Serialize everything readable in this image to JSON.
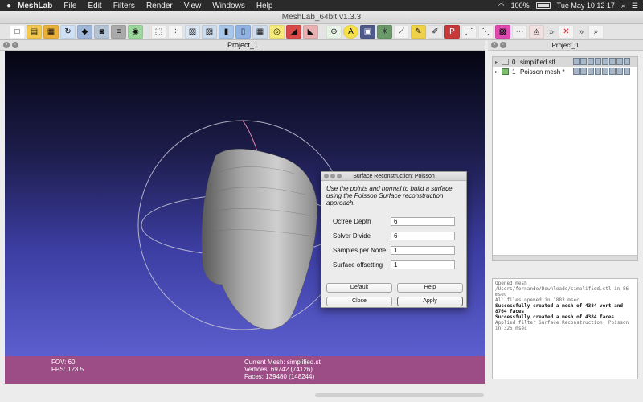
{
  "menubar": {
    "app_name": "MeshLab",
    "menus": [
      "File",
      "Edit",
      "Filters",
      "Render",
      "View",
      "Windows",
      "Help"
    ],
    "battery": "100%",
    "clock": "Tue May 10  12 17"
  },
  "window": {
    "title": "MeshLab_64bit v1.3.3"
  },
  "toolbar": {
    "icons": [
      "new-icon",
      "open-icon",
      "open-project-icon",
      "reload-icon",
      "save-icon",
      "snapshot-icon",
      "layers-icon",
      "globe-icon",
      "bbox-icon",
      "points-icon",
      "wireframe-icon",
      "hidden-lines-icon",
      "flat-icon",
      "smooth-icon",
      "texture-icon",
      "light-icon",
      "fancy-light-icon",
      "color-icon",
      "axis-icon",
      "annotation-icon",
      "selection-icon",
      "measure-icon",
      "align-icon",
      "pick-icon",
      "paint-icon",
      "paint-p-icon",
      "measure-tool-icon",
      "reference-icon",
      "color-swatch-icon",
      "raster-icon",
      "no-select-icon"
    ]
  },
  "project": {
    "title": "Project_1",
    "statusbar": {
      "fov": "FOV: 60",
      "fps": "FPS:   123.5",
      "current_mesh": "Current Mesh: simplified.stl",
      "vertices": "Vertices: 69742 (74126)",
      "faces": "Faces: 139480 (148244)"
    }
  },
  "dialog": {
    "title": "Surface Reconstruction: Poisson",
    "description": "Use the points and normal to build a surface using the Poisson Surface reconstruction approach.",
    "params": [
      {
        "label": "Octree Depth",
        "value": "6"
      },
      {
        "label": "Solver Divide",
        "value": "6"
      },
      {
        "label": "Samples per Node",
        "value": "1"
      },
      {
        "label": "Surface offsetting",
        "value": "1"
      }
    ],
    "buttons": {
      "default": "Default",
      "help": "Help",
      "close": "Close",
      "apply": "Apply"
    }
  },
  "layers_panel": {
    "title": "Project_1",
    "layers": [
      {
        "index": "0",
        "name": "simplified.stl"
      },
      {
        "index": "1",
        "name": "Poisson mesh *"
      }
    ]
  },
  "log": {
    "lines": [
      {
        "text": "Opened mesh /Users/fernando/Downloads/simplified.stl in 86 msec",
        "bold": false
      },
      {
        "text": "All files opened in 1883 msec",
        "bold": false
      },
      {
        "text": "Successfully created a mesh of 4384 vert and 8764 faces",
        "bold": true
      },
      {
        "text": "Successfully created a mesh of 4384 faces",
        "bold": true
      },
      {
        "text": "Applied filter Surface Reconstruction: Poisson in 325 msec",
        "bold": false
      }
    ]
  }
}
